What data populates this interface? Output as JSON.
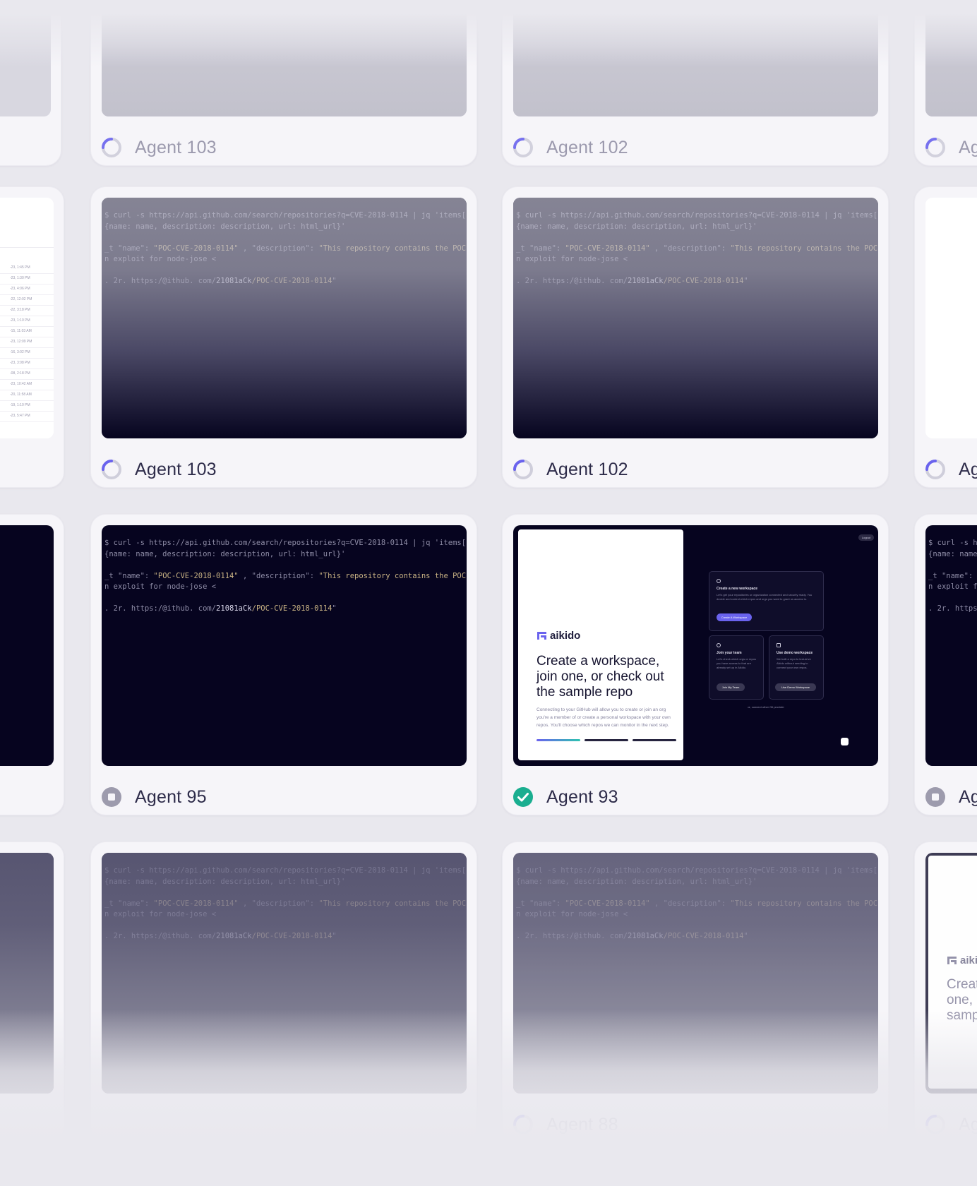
{
  "terminal": {
    "line1": "$ curl -s https://api.github.com/search/repositories?q=CVE-2018-0114 | jq 'items[]",
    "line2": "{name: name, description: description, url: html_url}'",
    "line3_a": "_t \"name\": ",
    "line3_b": "\"POC-CVE-2018-0114\"",
    "line3_c": " , \"description\": ",
    "line3_d": "\"This repository contains the POC o",
    "line4": "n exploit for node-jose <",
    "line5_a": ". 2r. https:/@ithub. com/",
    "line5_b": "21081aCk",
    "line5_c": "/POC-CVE-2018-0114",
    "line5_d": "\""
  },
  "aikido": {
    "brand": "aikido",
    "heading": "Create a workspace, join one, or check out the sample repo",
    "body": "Connecting to your GitHub will allow you to create or join an org you're a member of or create a personal workspace with your own repos. You'll choose which repos we can monitor in the next step.",
    "logout": "Logout",
    "create_title": "Create a new workspace",
    "create_desc": "Let's get your repositories or organization connected and security ready. You decide and control which repos and orgs you want to grant us access to.",
    "create_button": "Create A Workspace",
    "join_title": "Join your team",
    "join_desc": "Let's check which orgs or repos you have access to that are already set up in Aikido.",
    "join_button": "Join My Team",
    "demo_title": "Use demo workspace",
    "demo_desc": "We built a repo to test-drive Aikido without needing to connect your own repos.",
    "demo_button": "Use Demo Workspace",
    "or_text": "or, connect other Git provider"
  },
  "agents": [
    {
      "id": "agent-103-top",
      "name": "Agent 103",
      "status": "running"
    },
    {
      "id": "agent-102-top",
      "name": "Agent 102",
      "status": "running"
    },
    {
      "id": "agent-partial-top",
      "name": "Ag",
      "status": "running"
    },
    {
      "id": "agent-103",
      "name": "Agent 103",
      "status": "running"
    },
    {
      "id": "agent-102",
      "name": "Agent 102",
      "status": "running"
    },
    {
      "id": "agent-partial-row1",
      "name": "Ag",
      "status": "running"
    },
    {
      "id": "agent-95",
      "name": "Agent 95",
      "status": "stopped"
    },
    {
      "id": "agent-93",
      "name": "Agent 93",
      "status": "completed"
    },
    {
      "id": "agent-partial-row2",
      "name": "Ag",
      "status": "stopped"
    },
    {
      "id": "agent-88",
      "name": "Agent 88",
      "status": "running"
    },
    {
      "id": "agent-partial-row3",
      "name": "Ag",
      "status": "running"
    }
  ],
  "table_rows": [
    "-23, 1:45 PM",
    "-23, 1:30 PM",
    "-23, 4:06 PM",
    "-22, 12:02 PM",
    "-22, 3:18 PM",
    "-23, 1:10 PM",
    "-15, 11:03 AM",
    "-23, 12:09 PM",
    "-16, 3:02 PM",
    "-23, 3:08 PM",
    "-08, 2:18 PM",
    "-23, 10:42 AM",
    "-20, 11:58 AM",
    "-19, 1:10 PM",
    "-23, 5:47 PM"
  ],
  "colors": {
    "background": "#e9e8ee",
    "card": "#f6f5f9",
    "screen": "#06041f",
    "accent": "#6a63ee",
    "success": "#1aae90",
    "stopped": "#9d9bad"
  }
}
